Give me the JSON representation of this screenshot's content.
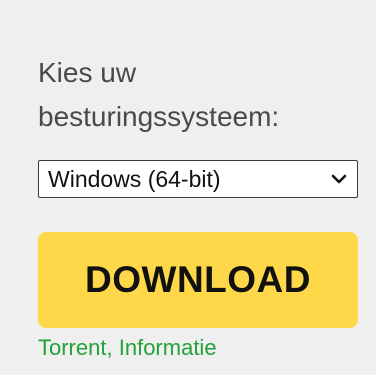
{
  "os_prompt": {
    "line1": "Kies uw",
    "line2": "besturingssysteem:"
  },
  "os_select": {
    "selected_value": "Windows (64-bit)",
    "icon": "chevron-down-icon"
  },
  "download_button": {
    "label": "DOWNLOAD",
    "color": "#ffd84a"
  },
  "links": {
    "torrent": "Torrent",
    "separator": ",",
    "info": "Informatie",
    "color": "#23a23a"
  },
  "panel": {
    "background": "#efefef"
  }
}
